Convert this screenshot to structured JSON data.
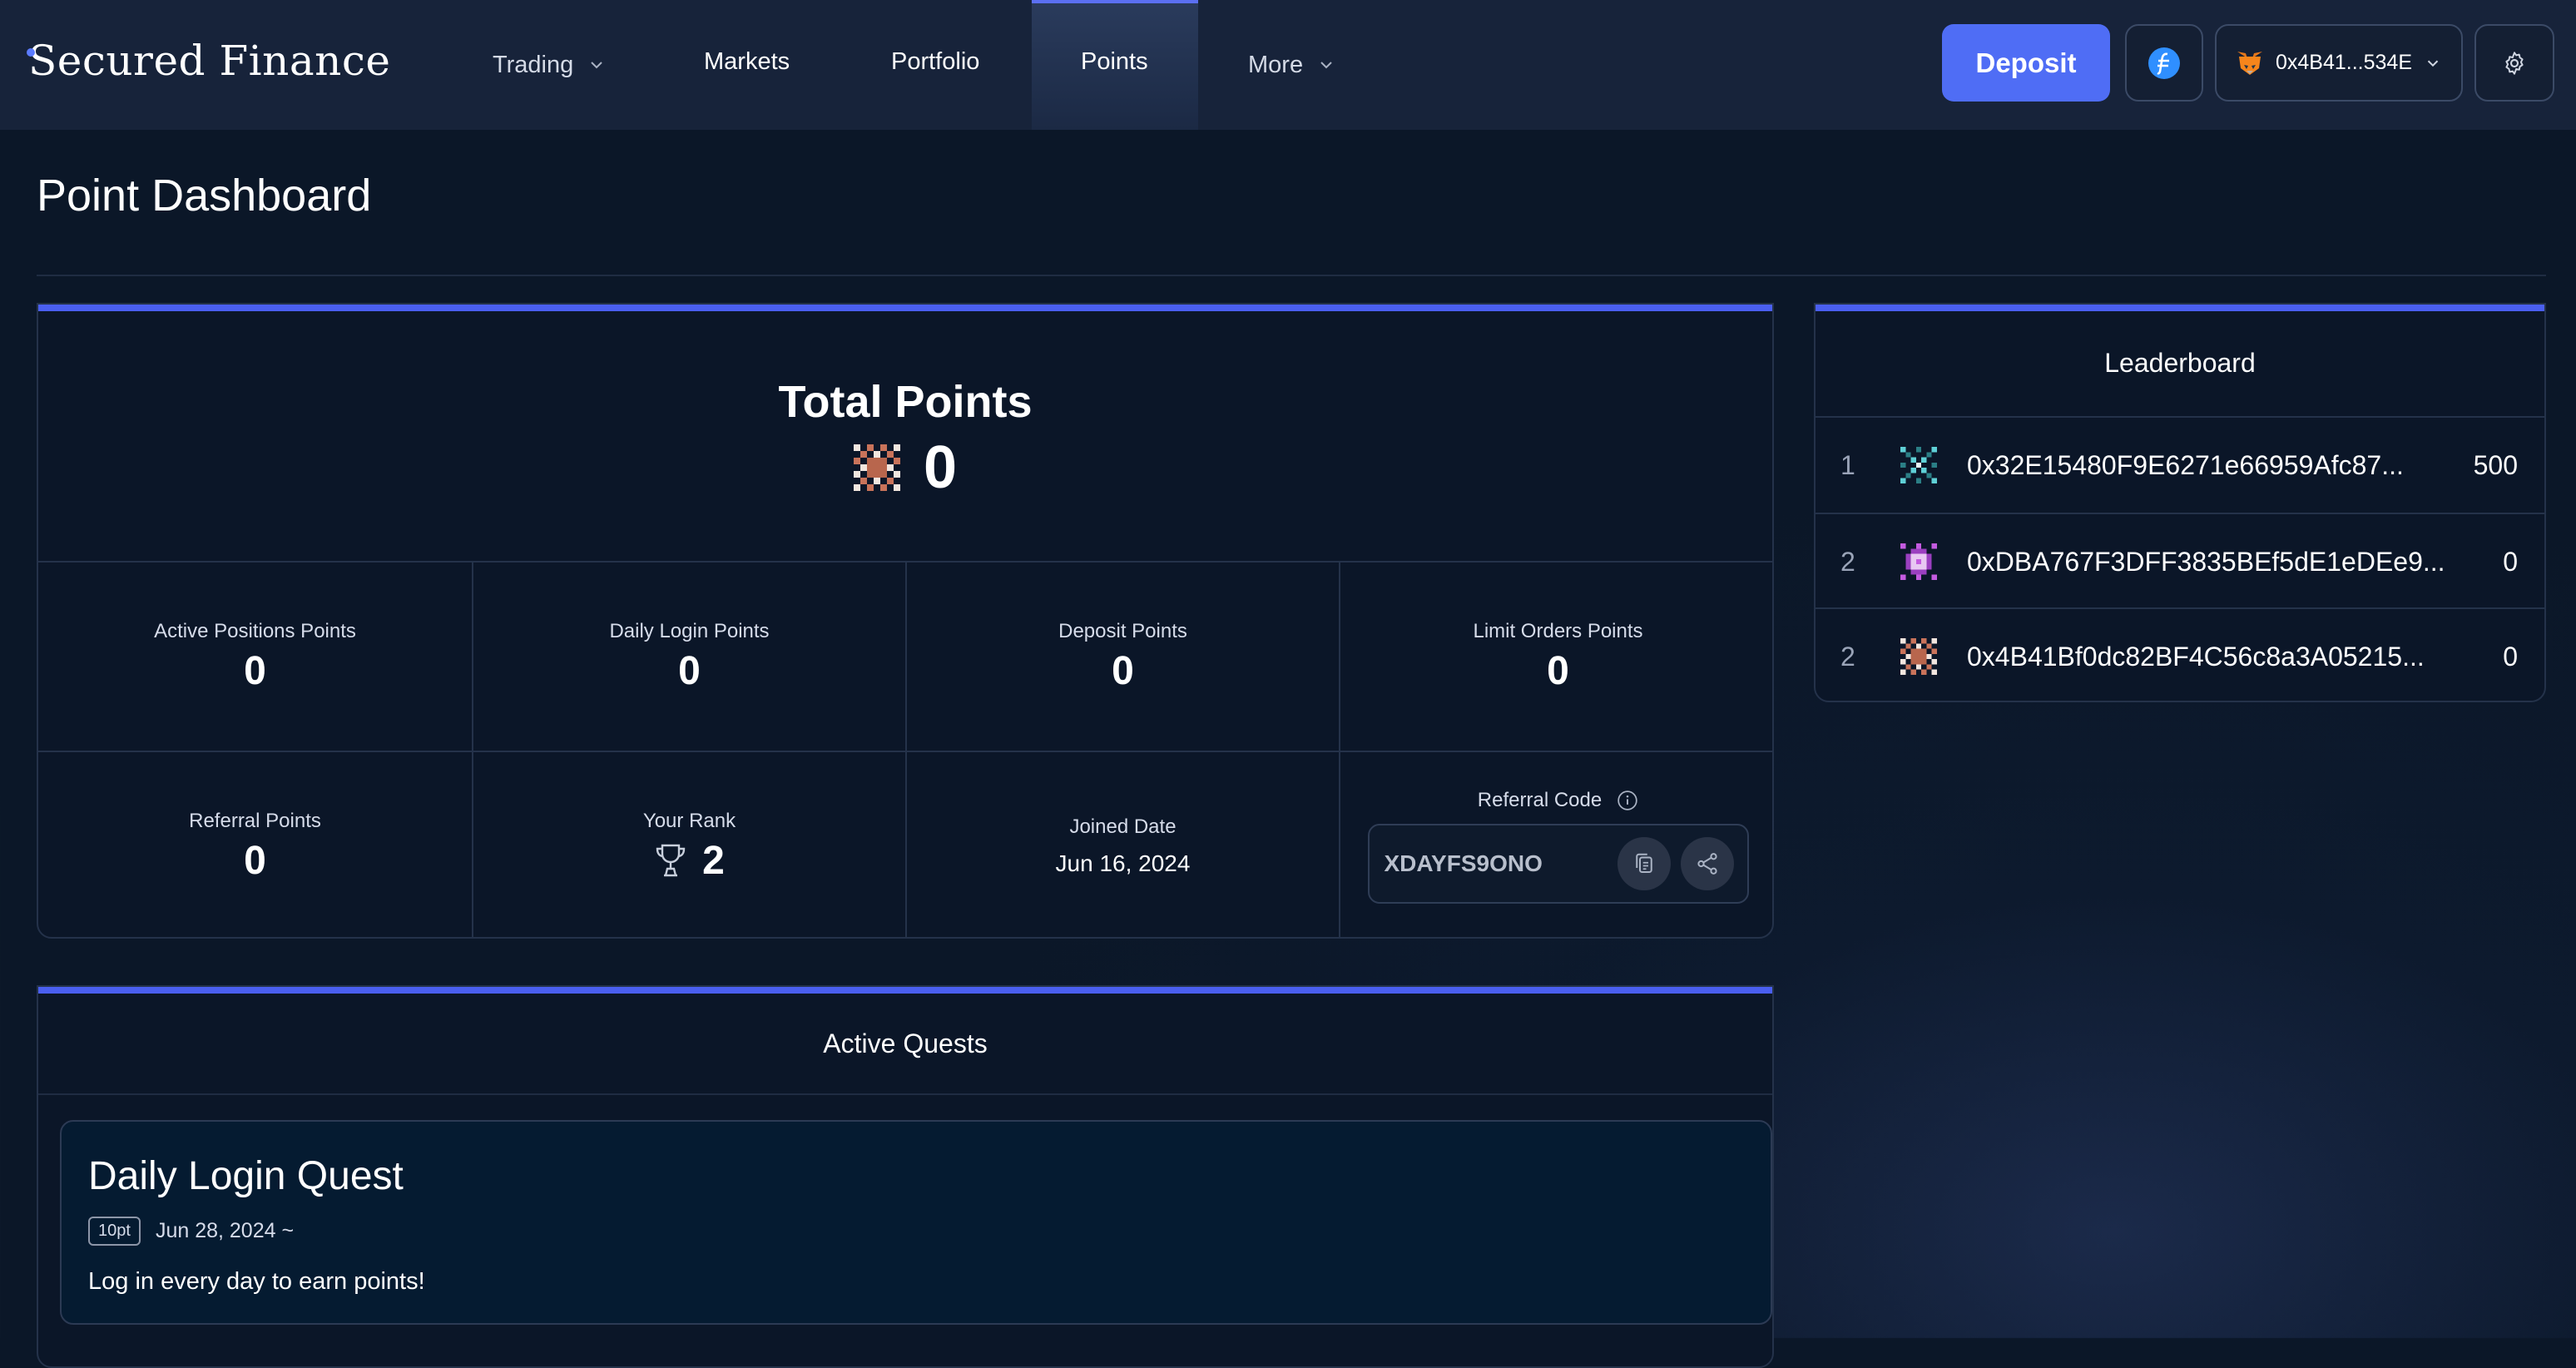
{
  "header": {
    "logo": "Secured Finance",
    "nav": [
      {
        "label": "Trading",
        "has_dropdown": true
      },
      {
        "label": "Markets",
        "has_dropdown": false
      },
      {
        "label": "Portfolio",
        "has_dropdown": false
      },
      {
        "label": "Points",
        "has_dropdown": false,
        "active": true
      },
      {
        "label": "More",
        "has_dropdown": true
      }
    ],
    "deposit_label": "Deposit",
    "network_icon": "filecoin-icon",
    "wallet": {
      "address": "0x4B41...534E",
      "icon": "metamask-fox-icon"
    },
    "settings_icon": "gear-icon"
  },
  "page": {
    "title": "Point Dashboard"
  },
  "total": {
    "title": "Total Points",
    "value": "0",
    "icon": "pixel-avatar-icon"
  },
  "stats": {
    "active_positions": {
      "label": "Active Positions Points",
      "value": "0"
    },
    "daily_login": {
      "label": "Daily Login Points",
      "value": "0"
    },
    "deposit": {
      "label": "Deposit Points",
      "value": "0"
    },
    "limit_orders": {
      "label": "Limit Orders Points",
      "value": "0"
    },
    "referral": {
      "label": "Referral Points",
      "value": "0"
    },
    "rank": {
      "label": "Your Rank",
      "value": "2",
      "icon": "trophy-icon"
    },
    "joined": {
      "label": "Joined Date",
      "value": "Jun 16, 2024"
    },
    "referral_code": {
      "label": "Referral Code",
      "value": "XDAYFS9ONO",
      "info_icon": "info-icon",
      "copy_icon": "copy-icon",
      "share_icon": "share-icon"
    }
  },
  "leaderboard": {
    "title": "Leaderboard",
    "rows": [
      {
        "rank": "1",
        "address": "0x32E15480F9E6271e66959Afc87...",
        "points": "500",
        "avatar_color": "#5fd0d6"
      },
      {
        "rank": "2",
        "address": "0xDBA767F3DFF3835BEf5dE1eDEe9...",
        "points": "0",
        "avatar_color": "#c45be0"
      },
      {
        "rank": "2",
        "address": "0x4B41Bf0dc82BF4C56c8a3A05215...",
        "points": "0",
        "avatar_color": "#c9735a"
      }
    ]
  },
  "quests": {
    "title": "Active Quests",
    "items": [
      {
        "name": "Daily Login Quest",
        "badge": "10pt",
        "date": "Jun 28, 2024 ~",
        "description": "Log in every day to earn points!"
      }
    ]
  },
  "colors": {
    "accent": "#4a5ff0",
    "deposit": "#4f6df5",
    "background": "#0b1728"
  }
}
